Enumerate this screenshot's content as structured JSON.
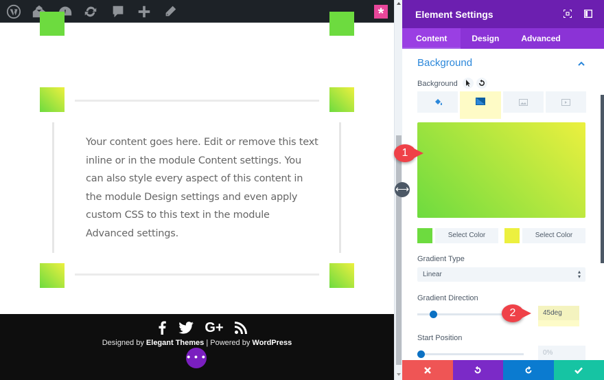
{
  "admin_bar": {
    "icons": [
      "wordpress-icon",
      "my-sites-icon",
      "dashboard-icon",
      "updates-icon",
      "comments-icon",
      "new-content-icon",
      "edit-icon"
    ],
    "divi_badge": "*"
  },
  "content": {
    "paragraph": "Your content goes here. Edit or remove this text inline or in the module Content settings. You can also style every aspect of this content in the module Design settings and even apply custom CSS to this text in the module Advanced settings."
  },
  "footer": {
    "social": [
      "facebook",
      "twitter",
      "google-plus",
      "rss"
    ],
    "google_plus_label": "G+",
    "credits_prefix": "Designed by ",
    "credits_brand": "Elegant Themes",
    "credits_middle": " | Powered by ",
    "credits_platform": "WordPress",
    "more_label": "• • •"
  },
  "panel": {
    "title": "Element Settings",
    "tabs": [
      {
        "label": "Content",
        "active": true
      },
      {
        "label": "Design",
        "active": false
      },
      {
        "label": "Advanced",
        "active": false
      }
    ],
    "section": {
      "title": "Background",
      "expanded": true
    },
    "background": {
      "label": "Background",
      "type_tabs": [
        {
          "name": "color",
          "active": false
        },
        {
          "name": "gradient",
          "active": true
        },
        {
          "name": "image",
          "active": false
        },
        {
          "name": "video",
          "active": false
        }
      ],
      "gradient_start_color": "#6ddb3f",
      "gradient_end_color": "#ecf03f",
      "select_color_label_1": "Select Color",
      "select_color_label_2": "Select Color",
      "gradient_type_label": "Gradient Type",
      "gradient_type_value": "Linear",
      "gradient_direction_label": "Gradient Direction",
      "gradient_direction_value": "45deg",
      "gradient_direction_fraction": 0.125,
      "start_position_label": "Start Position",
      "start_position_value": "0%",
      "start_position_fraction": 0
    },
    "footer_buttons": [
      {
        "name": "discard",
        "color": "#ef5555"
      },
      {
        "name": "undo",
        "color": "#7b2ac7"
      },
      {
        "name": "redo",
        "color": "#0b7bd0"
      },
      {
        "name": "save",
        "color": "#16c4a3"
      }
    ]
  },
  "annotations": {
    "marker_1": "1",
    "marker_2": "2"
  },
  "colors": {
    "panel_header": "#6c1fb0",
    "panel_tabs": "#8b33d6",
    "accent_blue": "#2b87da",
    "annotation_red": "#ef4148"
  }
}
